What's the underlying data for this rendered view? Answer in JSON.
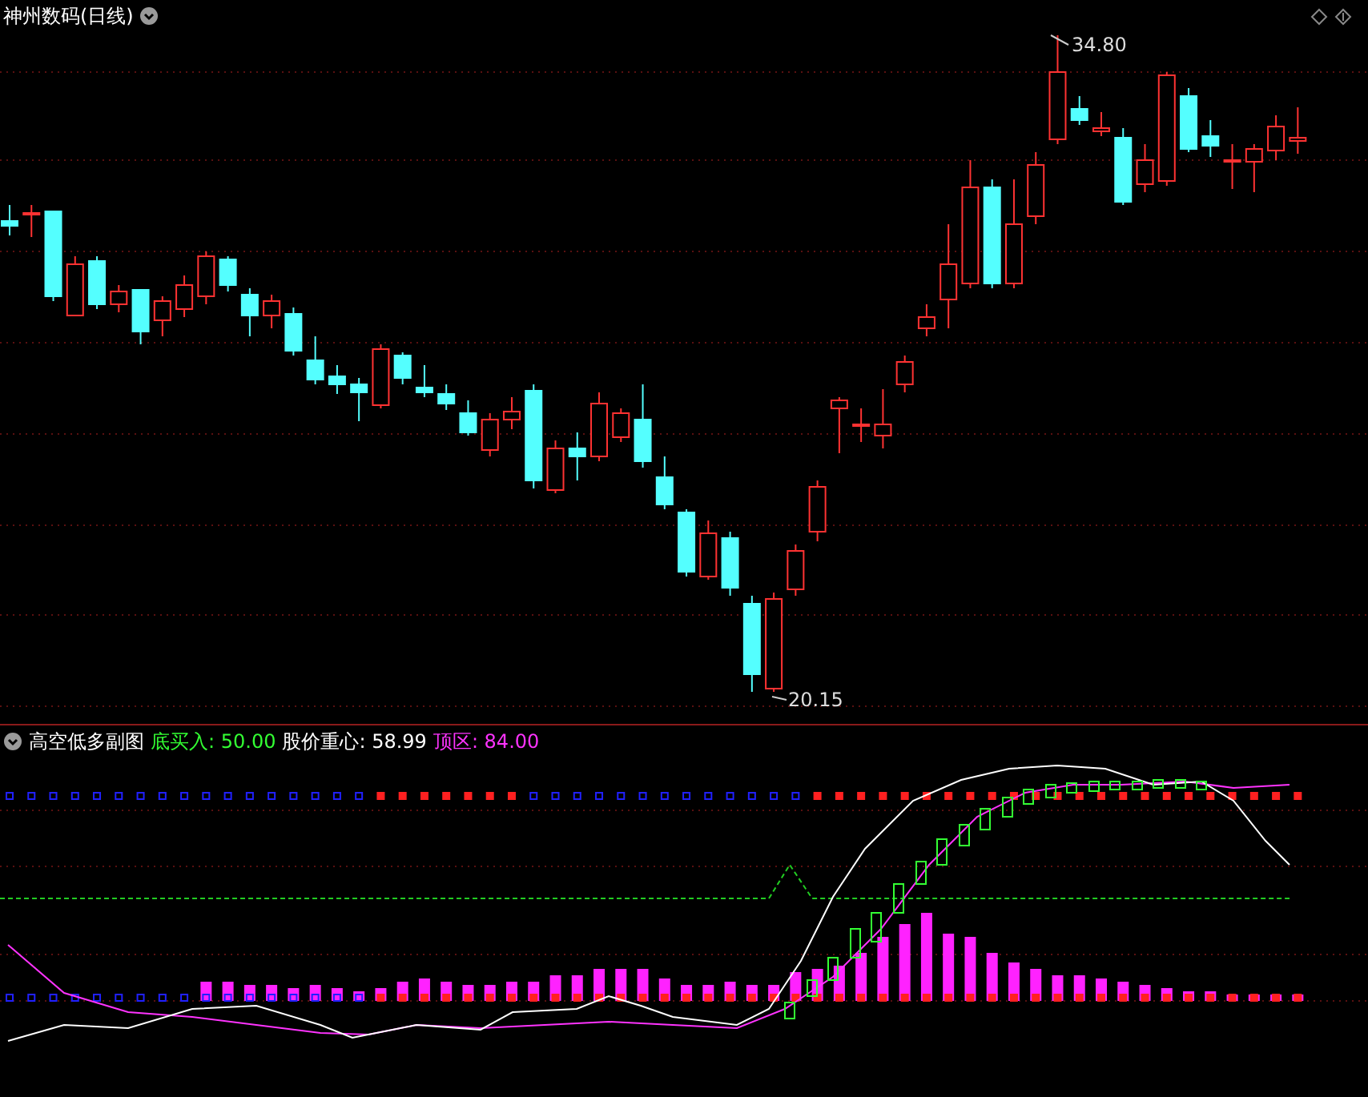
{
  "chart": {
    "title": "神州数码(日线)",
    "high_label": "34.80",
    "low_label": "20.15"
  },
  "indicator": {
    "title": "高空低多副图",
    "readings": [
      {
        "text": "底买入: 50.00",
        "color": "#33ff33"
      },
      {
        "text": "股价重心: 58.99",
        "color": "#ffffff"
      },
      {
        "text": "顶区: 84.00",
        "color": "#ff33ff"
      }
    ]
  }
}
